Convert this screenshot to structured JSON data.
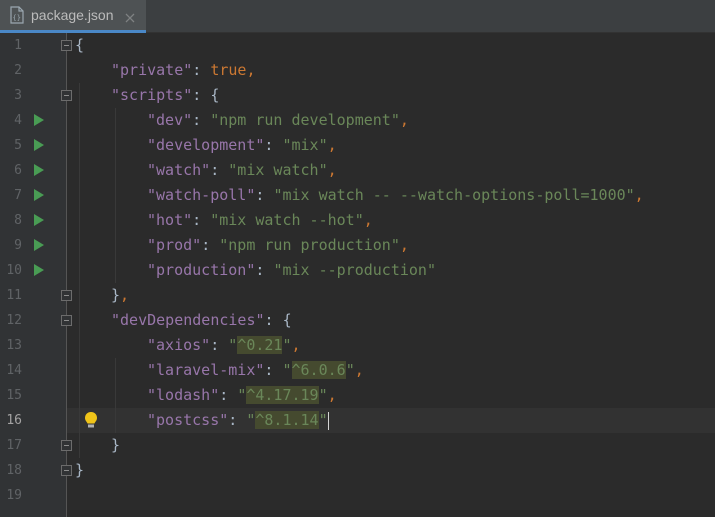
{
  "tab": {
    "label": "package.json",
    "icon": "json-file-icon",
    "close_icon": "close-icon"
  },
  "editor": {
    "current_line": 16,
    "lines": [
      {
        "n": "1",
        "tokens": [
          {
            "t": "{",
            "c": "brace"
          }
        ]
      },
      {
        "n": "2",
        "tokens": [
          {
            "t": "\"private\"",
            "c": "key"
          },
          {
            "t": ": ",
            "c": "brace"
          },
          {
            "t": "true",
            "c": "kw"
          },
          {
            "t": ",",
            "c": "punct"
          }
        ]
      },
      {
        "n": "3",
        "tokens": [
          {
            "t": "\"scripts\"",
            "c": "key"
          },
          {
            "t": ": {",
            "c": "brace"
          }
        ]
      },
      {
        "n": "4",
        "tokens": [
          {
            "t": "\"dev\"",
            "c": "key"
          },
          {
            "t": ": ",
            "c": "brace"
          },
          {
            "t": "\"npm run development\"",
            "c": "str"
          },
          {
            "t": ",",
            "c": "punct"
          }
        ]
      },
      {
        "n": "5",
        "tokens": [
          {
            "t": "\"development\"",
            "c": "key"
          },
          {
            "t": ": ",
            "c": "brace"
          },
          {
            "t": "\"mix\"",
            "c": "str"
          },
          {
            "t": ",",
            "c": "punct"
          }
        ]
      },
      {
        "n": "6",
        "tokens": [
          {
            "t": "\"watch\"",
            "c": "key"
          },
          {
            "t": ": ",
            "c": "brace"
          },
          {
            "t": "\"mix watch\"",
            "c": "str"
          },
          {
            "t": ",",
            "c": "punct"
          }
        ]
      },
      {
        "n": "7",
        "tokens": [
          {
            "t": "\"watch-poll\"",
            "c": "key"
          },
          {
            "t": ": ",
            "c": "brace"
          },
          {
            "t": "\"mix watch -- --watch-options-poll=1000\"",
            "c": "str"
          },
          {
            "t": ",",
            "c": "punct"
          }
        ]
      },
      {
        "n": "8",
        "tokens": [
          {
            "t": "\"hot\"",
            "c": "key"
          },
          {
            "t": ": ",
            "c": "brace"
          },
          {
            "t": "\"mix watch --hot\"",
            "c": "str"
          },
          {
            "t": ",",
            "c": "punct"
          }
        ]
      },
      {
        "n": "9",
        "tokens": [
          {
            "t": "\"prod\"",
            "c": "key"
          },
          {
            "t": ": ",
            "c": "brace"
          },
          {
            "t": "\"npm run production\"",
            "c": "str"
          },
          {
            "t": ",",
            "c": "punct"
          }
        ]
      },
      {
        "n": "10",
        "tokens": [
          {
            "t": "\"production\"",
            "c": "key"
          },
          {
            "t": ": ",
            "c": "brace"
          },
          {
            "t": "\"mix --production\"",
            "c": "str"
          }
        ]
      },
      {
        "n": "11",
        "tokens": [
          {
            "t": "}",
            "c": "brace"
          },
          {
            "t": ",",
            "c": "punct"
          }
        ]
      },
      {
        "n": "12",
        "tokens": [
          {
            "t": "\"devDependencies\"",
            "c": "key"
          },
          {
            "t": ": {",
            "c": "brace"
          }
        ]
      },
      {
        "n": "13",
        "tokens": [
          {
            "t": "\"axios\"",
            "c": "key"
          },
          {
            "t": ": ",
            "c": "brace"
          },
          {
            "t": "\"",
            "c": "str"
          },
          {
            "t": "^0.21",
            "c": "str",
            "hl": true
          },
          {
            "t": "\"",
            "c": "str"
          },
          {
            "t": ",",
            "c": "punct"
          }
        ]
      },
      {
        "n": "14",
        "tokens": [
          {
            "t": "\"laravel-mix\"",
            "c": "key"
          },
          {
            "t": ": ",
            "c": "brace"
          },
          {
            "t": "\"",
            "c": "str"
          },
          {
            "t": "^6.0.6",
            "c": "str",
            "hl": true
          },
          {
            "t": "\"",
            "c": "str"
          },
          {
            "t": ",",
            "c": "punct"
          }
        ]
      },
      {
        "n": "15",
        "tokens": [
          {
            "t": "\"lodash\"",
            "c": "key"
          },
          {
            "t": ": ",
            "c": "brace"
          },
          {
            "t": "\"",
            "c": "str"
          },
          {
            "t": "^4.17.19",
            "c": "str",
            "hl": true
          },
          {
            "t": "\"",
            "c": "str"
          },
          {
            "t": ",",
            "c": "punct"
          }
        ]
      },
      {
        "n": "16",
        "tokens": [
          {
            "t": "\"postcss\"",
            "c": "key"
          },
          {
            "t": ": ",
            "c": "brace"
          },
          {
            "t": "\"",
            "c": "str"
          },
          {
            "t": "^8.1.14",
            "c": "str",
            "hl": true
          },
          {
            "t": "\"",
            "c": "str"
          }
        ],
        "caret": true
      },
      {
        "n": "17",
        "tokens": [
          {
            "t": "}",
            "c": "brace"
          }
        ]
      },
      {
        "n": "18",
        "tokens": [
          {
            "t": "}",
            "c": "brace"
          }
        ]
      },
      {
        "n": "19",
        "tokens": []
      }
    ]
  },
  "gutter": {
    "run_icon": "run-triangle-icon",
    "fold_icon": "fold-marker-icon",
    "bulb_icon": "intention-bulb-icon",
    "run_lines": [
      4,
      5,
      6,
      7,
      8,
      9,
      10
    ],
    "fold_lines": [
      1,
      3,
      11,
      12,
      17,
      18
    ],
    "bulb_line": 16
  },
  "colors": {
    "background": "#2b2b2b",
    "gutter": "#313335",
    "key": "#9876aa",
    "string": "#6a8759",
    "keyword": "#cc7832",
    "text": "#a9b7c6",
    "run": "#499c54",
    "bulb": "#f0c419",
    "tab_accent": "#4a88c7"
  }
}
